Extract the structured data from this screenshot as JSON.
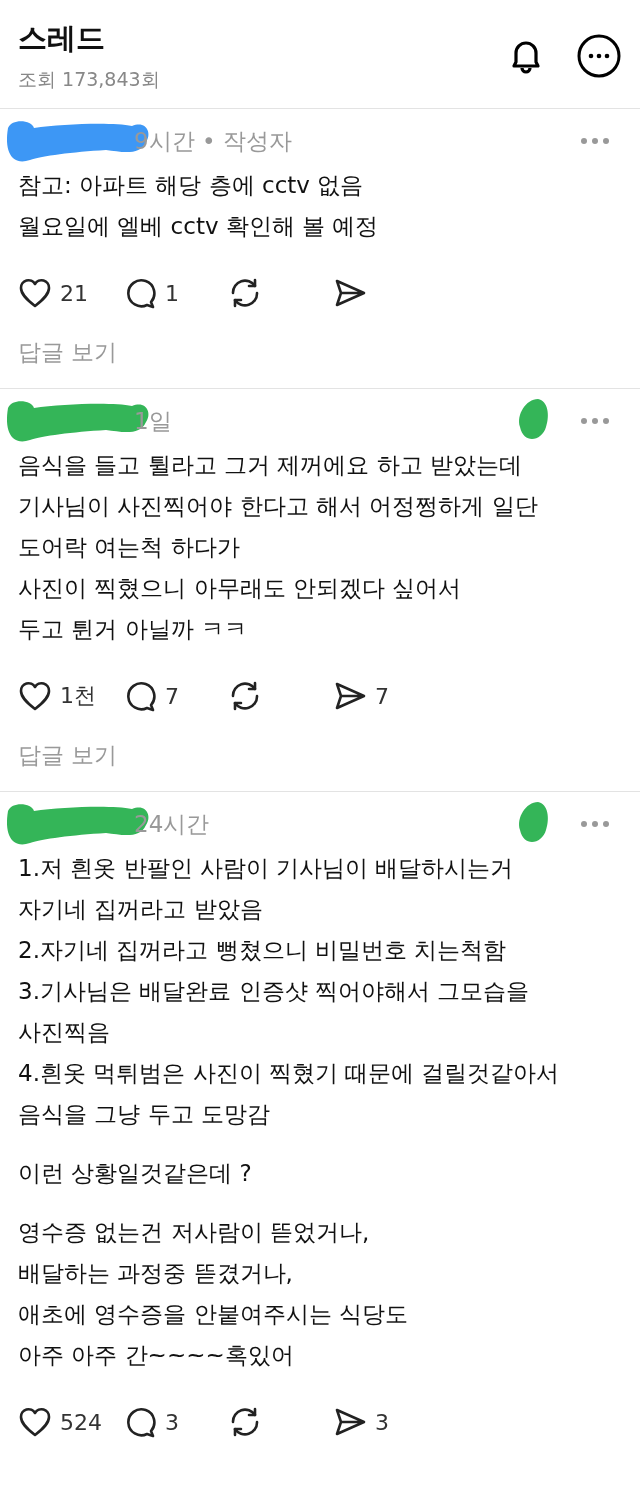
{
  "header": {
    "title": "스레드",
    "views": "조회 173,843회"
  },
  "comments": [
    {
      "marks": [
        {
          "kind": "name",
          "color": "#3d97f5"
        }
      ],
      "time": "9시간 • 작성자",
      "body": [
        "참고: 아파트 해당 층에 cctv 없음\n월요일에 엘베 cctv 확인해 볼 예정"
      ],
      "actions": [
        {
          "kind": "like",
          "count": "21"
        },
        {
          "kind": "reply",
          "count": "1"
        },
        {
          "kind": "repost"
        },
        {
          "kind": "share"
        }
      ],
      "replies_link": "답글 보기"
    },
    {
      "marks": [
        {
          "kind": "name",
          "color": "#34b558"
        },
        {
          "kind": "badge",
          "color": "#34b558"
        }
      ],
      "time": "1일",
      "body": [
        "음식을 들고 튈라고 그거 제꺼에요 하고 받았는데\n기사님이 사진찍어야 한다고 해서 어정쩡하게 일단\n도어락 여는척 하다가\n사진이 찍혔으니 아무래도 안되겠다 싶어서\n두고 튄거 아닐까 ㅋㅋ"
      ],
      "actions": [
        {
          "kind": "like",
          "count": "1천"
        },
        {
          "kind": "reply",
          "count": "7"
        },
        {
          "kind": "repost"
        },
        {
          "kind": "share",
          "count": "7"
        }
      ],
      "replies_link": "답글 보기"
    },
    {
      "marks": [
        {
          "kind": "name",
          "color": "#34b558"
        },
        {
          "kind": "badge",
          "color": "#34b558"
        }
      ],
      "time": "24시간",
      "body": [
        "1.저 흰옷 반팔인 사람이 기사님이 배달하시는거\n자기네 집꺼라고 받았음\n2.자기네 집꺼라고 뻥쳤으니 비밀번호 치는척함\n3.기사님은 배달완료 인증샷 찍어야해서 그모습을\n사진찍음\n4.흰옷 먹튀범은 사진이 찍혔기 때문에 걸릴것같아서\n음식을 그냥 두고 도망감",
        "이런 상황일것같은데 ?",
        "영수증 없는건 저사람이 뜯었거나,\n배달하는 과정중 뜯겼거나,\n애초에 영수증을 안붙여주시는 식당도\n아주 아주 간~~~~혹있어"
      ],
      "actions": [
        {
          "kind": "like",
          "count": "524"
        },
        {
          "kind": "reply",
          "count": "3"
        },
        {
          "kind": "repost"
        },
        {
          "kind": "share",
          "count": "3"
        }
      ]
    }
  ]
}
